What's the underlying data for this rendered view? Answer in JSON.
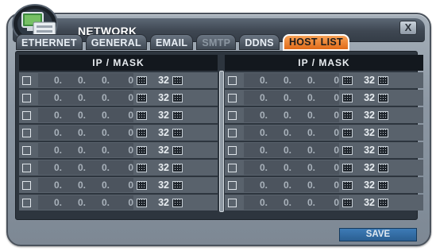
{
  "window": {
    "title": "NETWORK",
    "close_label": "X"
  },
  "tabs": [
    {
      "label": "ETHERNET",
      "state": "normal"
    },
    {
      "label": "GENERAL",
      "state": "normal"
    },
    {
      "label": "EMAIL",
      "state": "normal"
    },
    {
      "label": "SMTP",
      "state": "disabled"
    },
    {
      "label": "DDNS",
      "state": "normal"
    },
    {
      "label": "HOST LIST",
      "state": "active"
    }
  ],
  "host_list": {
    "left_header": "IP / MASK",
    "right_header": "IP / MASK",
    "left_rows": [
      {
        "checked": false,
        "ip": [
          "0.",
          "0.",
          "0.",
          "0"
        ],
        "mask": "32"
      },
      {
        "checked": false,
        "ip": [
          "0.",
          "0.",
          "0.",
          "0"
        ],
        "mask": "32"
      },
      {
        "checked": false,
        "ip": [
          "0.",
          "0.",
          "0.",
          "0"
        ],
        "mask": "32"
      },
      {
        "checked": false,
        "ip": [
          "0.",
          "0.",
          "0.",
          "0"
        ],
        "mask": "32"
      },
      {
        "checked": false,
        "ip": [
          "0.",
          "0.",
          "0.",
          "0"
        ],
        "mask": "32"
      },
      {
        "checked": false,
        "ip": [
          "0.",
          "0.",
          "0.",
          "0"
        ],
        "mask": "32"
      },
      {
        "checked": false,
        "ip": [
          "0.",
          "0.",
          "0.",
          "0"
        ],
        "mask": "32"
      },
      {
        "checked": false,
        "ip": [
          "0.",
          "0.",
          "0.",
          "0"
        ],
        "mask": "32"
      }
    ],
    "right_rows": [
      {
        "checked": false,
        "ip": [
          "0.",
          "0.",
          "0.",
          "0"
        ],
        "mask": "32"
      },
      {
        "checked": false,
        "ip": [
          "0.",
          "0.",
          "0.",
          "0"
        ],
        "mask": "32"
      },
      {
        "checked": false,
        "ip": [
          "0.",
          "0.",
          "0.",
          "0"
        ],
        "mask": "32"
      },
      {
        "checked": false,
        "ip": [
          "0.",
          "0.",
          "0.",
          "0"
        ],
        "mask": "32"
      },
      {
        "checked": false,
        "ip": [
          "0.",
          "0.",
          "0.",
          "0"
        ],
        "mask": "32"
      },
      {
        "checked": false,
        "ip": [
          "0.",
          "0.",
          "0.",
          "0"
        ],
        "mask": "32"
      },
      {
        "checked": false,
        "ip": [
          "0.",
          "0.",
          "0.",
          "0"
        ],
        "mask": "32"
      },
      {
        "checked": false,
        "ip": [
          "0.",
          "0.",
          "0.",
          "0"
        ],
        "mask": "32"
      }
    ]
  },
  "footer": {
    "save_label": "SAVE"
  },
  "icons": {
    "logo": "network-computer-icon",
    "close": "close-icon",
    "keypad": "keypad-icon"
  },
  "colors": {
    "active_tab": "#f08a38",
    "save_button": "#3570a8",
    "panel_bg": "#2d353e"
  }
}
